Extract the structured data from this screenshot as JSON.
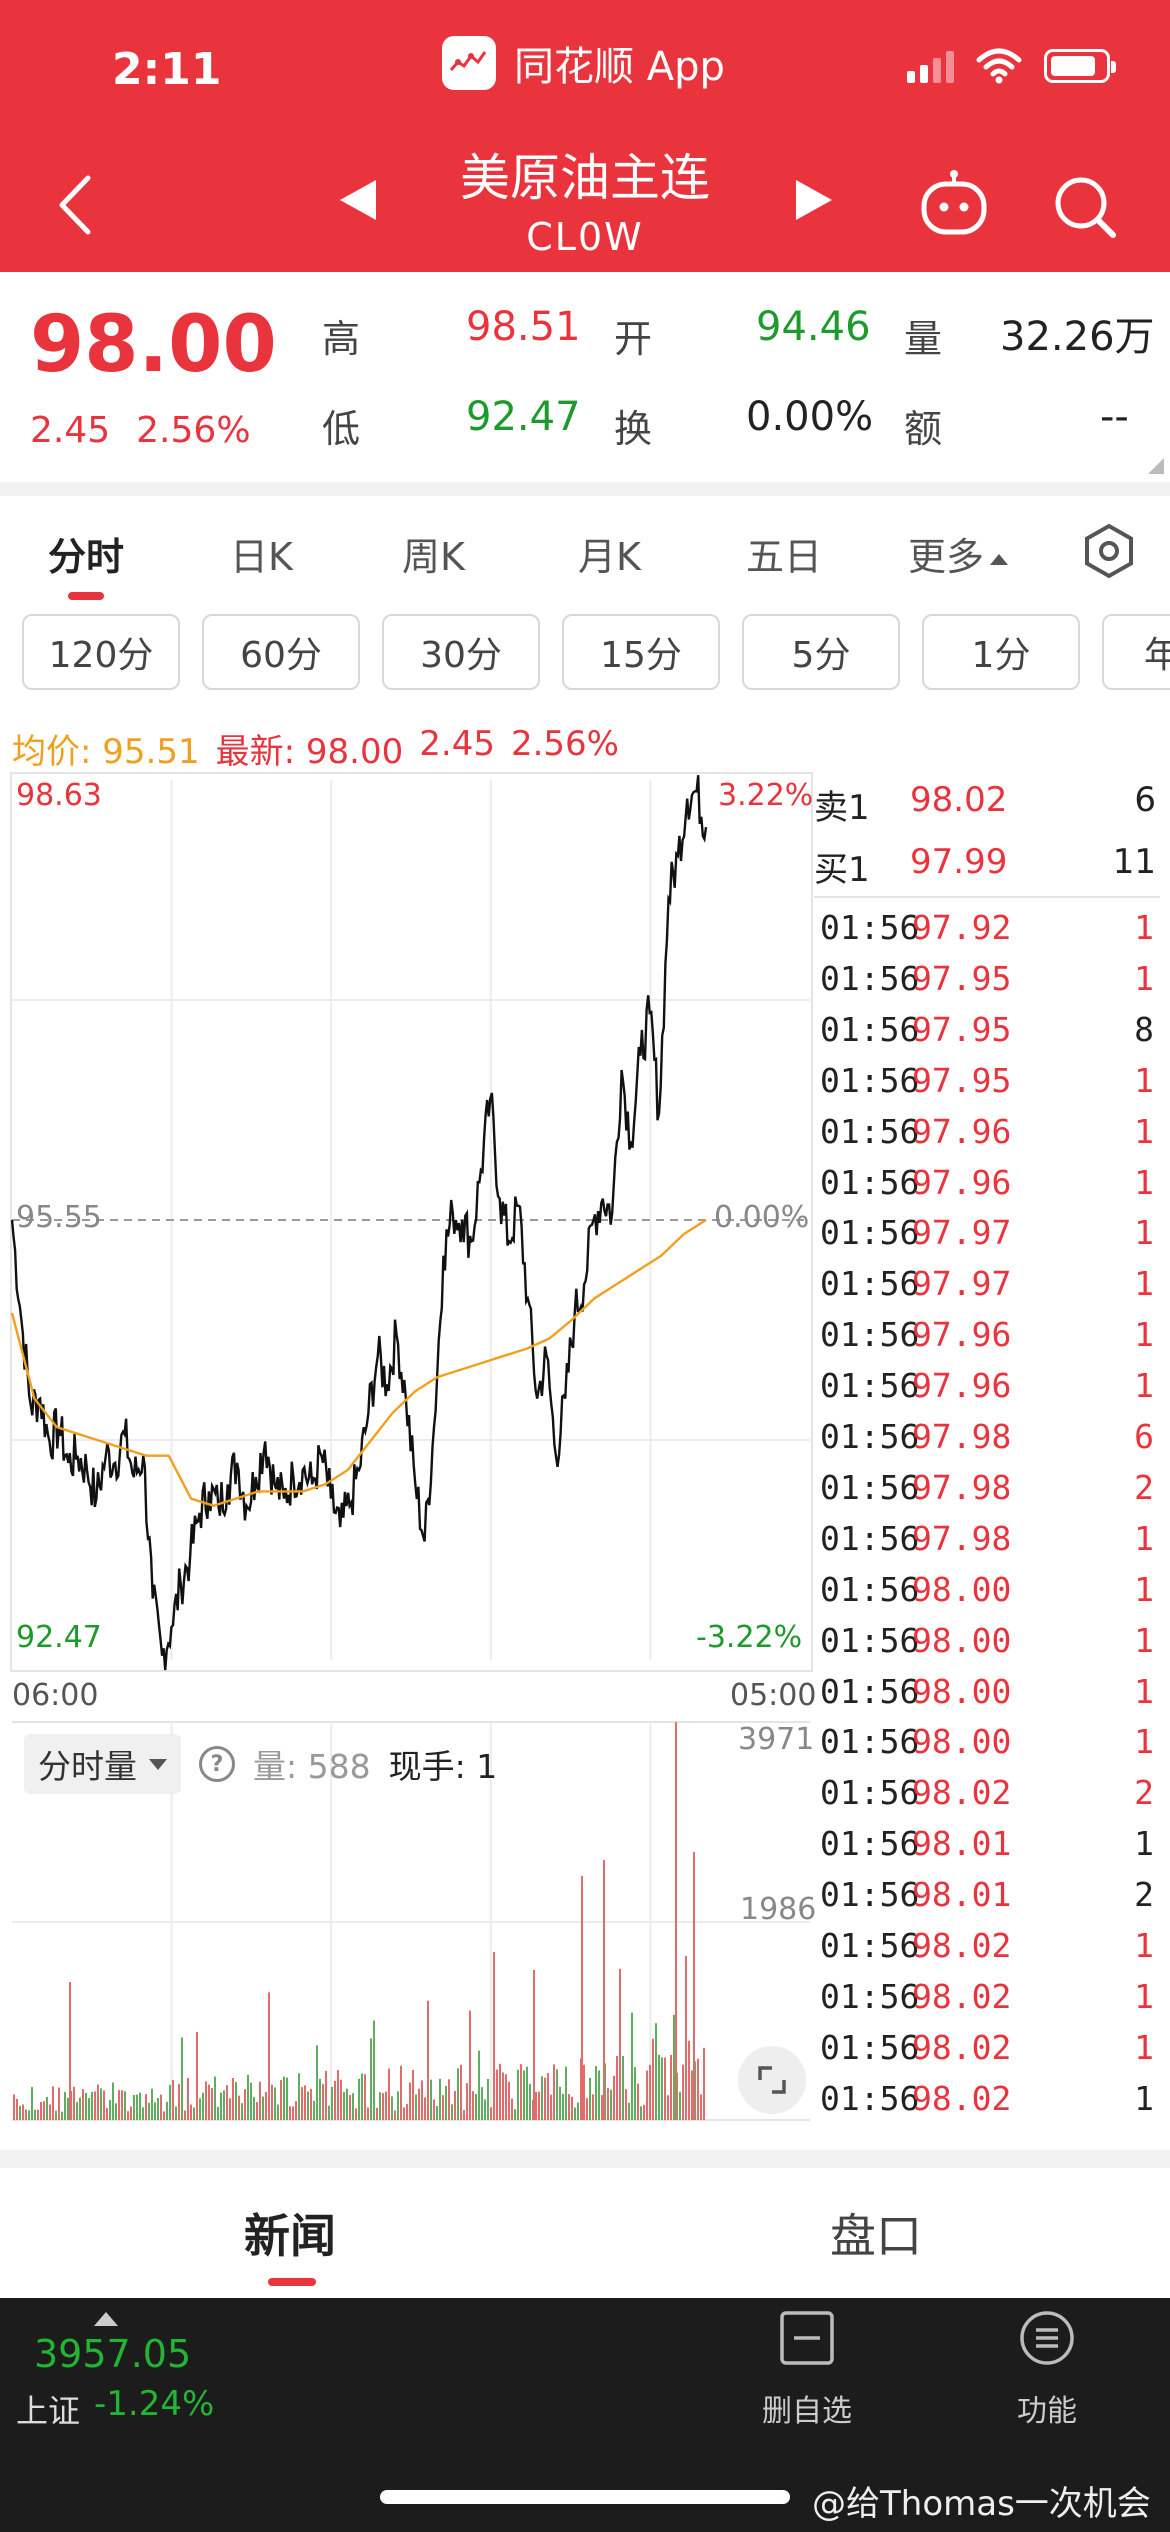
{
  "status_bar": {
    "time": "2:11",
    "app_name": "同花顺 App"
  },
  "header": {
    "title": "美原油主连",
    "code": "CL0W"
  },
  "quote": {
    "price": "98.00",
    "change": "2.45",
    "change_pct": "2.56%",
    "labels": {
      "high": "高",
      "low": "低",
      "open": "开",
      "turnover": "换",
      "volume": "量",
      "amount": "额"
    },
    "high": "98.51",
    "low": "92.47",
    "open": "94.46",
    "turnover": "0.00%",
    "volume": "32.26万",
    "amount": "--"
  },
  "tabs": [
    "分时",
    "日K",
    "周K",
    "月K",
    "五日",
    "更多"
  ],
  "periods": [
    "120分",
    "60分",
    "30分",
    "15分",
    "5分",
    "1分",
    "年"
  ],
  "info_line": {
    "avg_label": "均价:",
    "avg": "95.51",
    "latest_label": "最新:",
    "latest": "98.00",
    "chg": "2.45",
    "pct": "2.56%"
  },
  "chart": {
    "price_high": "98.63",
    "price_mid": "95.55",
    "price_low": "92.47",
    "pct_high": "3.22%",
    "pct_mid": "0.00%",
    "pct_low": "-3.22%",
    "time_start": "06:00",
    "time_end": "05:00",
    "vol_max": "3971",
    "vol_mid": "1986"
  },
  "volume_head": {
    "selector": "分时量",
    "vol_label": "量:",
    "vol_value": "588",
    "hand_label": "现手:",
    "hand_value": "1"
  },
  "order_book": {
    "sell_label": "卖1",
    "sell_price": "98.02",
    "sell_qty": "6",
    "buy_label": "买1",
    "buy_price": "97.99",
    "buy_qty": "11"
  },
  "ticks": [
    {
      "t": "01:56",
      "p": "97.92",
      "q": "1",
      "c": "red"
    },
    {
      "t": "01:56",
      "p": "97.95",
      "q": "1",
      "c": "red"
    },
    {
      "t": "01:56",
      "p": "97.95",
      "q": "8",
      "c": "dark"
    },
    {
      "t": "01:56",
      "p": "97.95",
      "q": "1",
      "c": "red"
    },
    {
      "t": "01:56",
      "p": "97.96",
      "q": "1",
      "c": "red"
    },
    {
      "t": "01:56",
      "p": "97.96",
      "q": "1",
      "c": "red"
    },
    {
      "t": "01:56",
      "p": "97.97",
      "q": "1",
      "c": "red"
    },
    {
      "t": "01:56",
      "p": "97.97",
      "q": "1",
      "c": "red"
    },
    {
      "t": "01:56",
      "p": "97.96",
      "q": "1",
      "c": "red"
    },
    {
      "t": "01:56",
      "p": "97.96",
      "q": "1",
      "c": "red"
    },
    {
      "t": "01:56",
      "p": "97.98",
      "q": "6",
      "c": "red"
    },
    {
      "t": "01:56",
      "p": "97.98",
      "q": "2",
      "c": "red"
    },
    {
      "t": "01:56",
      "p": "97.98",
      "q": "1",
      "c": "red"
    },
    {
      "t": "01:56",
      "p": "98.00",
      "q": "1",
      "c": "red"
    },
    {
      "t": "01:56",
      "p": "98.00",
      "q": "1",
      "c": "red"
    },
    {
      "t": "01:56",
      "p": "98.00",
      "q": "1",
      "c": "red"
    },
    {
      "t": "01:56",
      "p": "98.00",
      "q": "1",
      "c": "red"
    },
    {
      "t": "01:56",
      "p": "98.02",
      "q": "2",
      "c": "red"
    },
    {
      "t": "01:56",
      "p": "98.01",
      "q": "1",
      "c": "dark"
    },
    {
      "t": "01:56",
      "p": "98.01",
      "q": "2",
      "c": "dark"
    },
    {
      "t": "01:56",
      "p": "98.02",
      "q": "1",
      "c": "red"
    },
    {
      "t": "01:56",
      "p": "98.02",
      "q": "1",
      "c": "red"
    },
    {
      "t": "01:56",
      "p": "98.02",
      "q": "1",
      "c": "red"
    },
    {
      "t": "01:56",
      "p": "98.02",
      "q": "1",
      "c": "dark"
    }
  ],
  "news_tabs": [
    "新闻",
    "盘口"
  ],
  "bottom": {
    "index_value": "3957.05",
    "index_name": "上证",
    "index_pct": "-1.24%",
    "watchlist_btn": "删自选",
    "func_btn": "功能",
    "watermark": "@给Thomas一次机会"
  },
  "colors": {
    "brand": "#e9343d",
    "up": "#e9343d",
    "down": "#1d9a2b",
    "avg_line": "#f0a01e"
  },
  "chart_data": {
    "type": "line",
    "x": [
      "06:00",
      "05:00"
    ],
    "ylim": [
      92.47,
      98.63
    ],
    "series": [
      {
        "name": "",
        "color": "#111111",
        "values": [
          95.55,
          94.85,
          94.25,
          94.3,
          94.0,
          94.1,
          93.85,
          93.9,
          93.8,
          93.6,
          93.9,
          93.85,
          94.05,
          93.75,
          93.9,
          92.9,
          92.5,
          92.7,
          93.0,
          93.2,
          93.5,
          93.65,
          93.55,
          93.7,
          93.85,
          93.55,
          93.75,
          94.0,
          93.7,
          93.6,
          93.75,
          93.8,
          93.7,
          93.9,
          93.6,
          93.4,
          93.55,
          93.8,
          94.2,
          94.6,
          94.4,
          94.75,
          94.3,
          93.7,
          93.3,
          94.1,
          95.3,
          95.6,
          95.55,
          95.4,
          95.9,
          96.4,
          95.7,
          95.4,
          95.65,
          95.0,
          94.3,
          94.6,
          93.9,
          94.3,
          94.9,
          95.1,
          95.55,
          95.7,
          95.6,
          96.6,
          96.1,
          96.7,
          97.0,
          96.3,
          97.8,
          98.1,
          98.5,
          98.55,
          98.3
        ]
      },
      {
        "name": "",
        "color": "#f0a01e",
        "values": [
          94.9,
          94.3,
          94.1,
          94.05,
          94.0,
          93.95,
          93.9,
          93.9,
          93.6,
          93.55,
          93.6,
          93.65,
          93.65,
          93.65,
          93.7,
          93.8,
          94.0,
          94.2,
          94.35,
          94.45,
          94.5,
          94.55,
          94.6,
          94.65,
          94.72,
          94.85,
          95.0,
          95.1,
          95.2,
          95.3,
          95.45,
          95.55
        ]
      }
    ]
  }
}
